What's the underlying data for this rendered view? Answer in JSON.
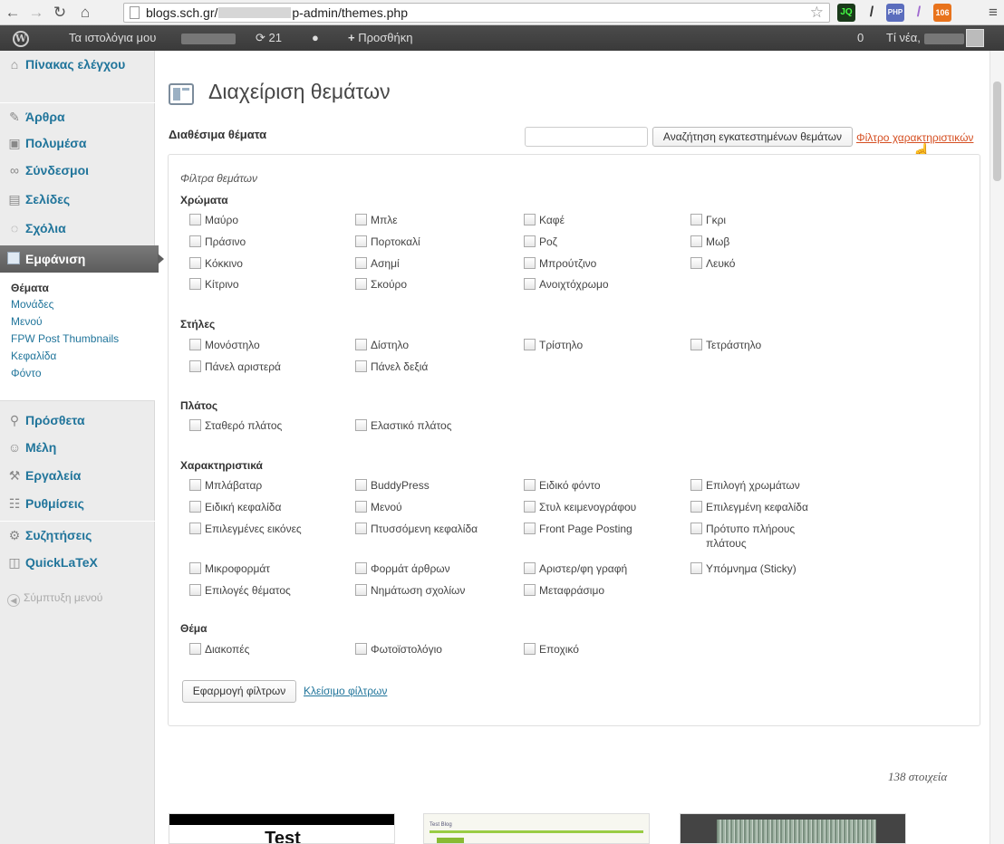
{
  "browser": {
    "url_prefix": "blogs.sch.gr/",
    "url_suffix": "p-admin/themes.php",
    "extensions": [
      "JQ",
      "PHP",
      "106"
    ]
  },
  "adminbar": {
    "my_blogs": "Τα ιστολόγια μου",
    "updates_count": "21",
    "add_new": "Προσθήκη",
    "notif_count": "0",
    "howdy": "Τί νέα,"
  },
  "sidebar": {
    "items": [
      {
        "label": "Πίνακας ελέγχου",
        "icon": "dashboard-icon"
      },
      {
        "label": "Άρθρα",
        "icon": "pin-icon"
      },
      {
        "label": "Πολυμέσα",
        "icon": "media-icon"
      },
      {
        "label": "Σύνδεσμοι",
        "icon": "link-icon"
      },
      {
        "label": "Σελίδες",
        "icon": "pages-icon"
      },
      {
        "label": "Σχόλια",
        "icon": "comments-icon"
      },
      {
        "label": "Εμφάνιση",
        "icon": "appearance-icon"
      },
      {
        "label": "Πρόσθετα",
        "icon": "plugins-icon"
      },
      {
        "label": "Μέλη",
        "icon": "users-icon"
      },
      {
        "label": "Εργαλεία",
        "icon": "tools-icon"
      },
      {
        "label": "Ρυθμίσεις",
        "icon": "settings-icon"
      },
      {
        "label": "Συζητήσεις",
        "icon": "gear-icon"
      },
      {
        "label": "QuickLaTeX",
        "icon": "quicklatex-icon"
      }
    ],
    "submenu": [
      "Θέματα",
      "Μονάδες",
      "Μενού",
      "FPW Post Thumbnails",
      "Κεφαλίδα",
      "Φόντο"
    ],
    "collapse": "Σύμπτυξη μενού"
  },
  "main": {
    "title": "Διαχείριση θεμάτων",
    "available": "Διαθέσιμα θέματα",
    "search_button": "Αναζήτηση εγκατεστημένων θεμάτων",
    "feature_filter": "Φίλτρο χαρακτηριστικών",
    "filters_title": "Φίλτρα θεμάτων",
    "groups": {
      "colors": {
        "title": "Χρώματα",
        "items": [
          "Μαύρο",
          "Μπλε",
          "Καφέ",
          "Γκρι",
          "Πράσινο",
          "Πορτοκαλί",
          "Ροζ",
          "Μωβ",
          "Κόκκινο",
          "Ασημί",
          "Μπρούτζινο",
          "Λευκό",
          "Κίτρινο",
          "Σκούρο",
          "Ανοιχτόχρωμο"
        ]
      },
      "columns": {
        "title": "Στήλες",
        "items": [
          "Μονόστηλο",
          "Δίστηλο",
          "Τρίστηλο",
          "Τετράστηλο",
          "Πάνελ αριστερά",
          "Πάνελ δεξιά"
        ]
      },
      "width": {
        "title": "Πλάτος",
        "items": [
          "Σταθερό πλάτος",
          "Ελαστικό πλάτος"
        ]
      },
      "features": {
        "title": "Χαρακτηριστικά",
        "items": [
          "Μπλάβαταρ",
          "BuddyPress",
          "Ειδικό φόντο",
          "Επιλογή χρωμάτων",
          "Ειδική κεφαλίδα",
          "Μενού",
          "Στυλ κειμενογράφου",
          "Επιλεγμένη κεφαλίδα",
          "Επιλεγμένες εικόνες",
          "Πτυσσόμενη κεφαλίδα",
          "Front Page Posting",
          "Πρότυπο πλήρους πλάτους",
          "Μικροφορμάτ",
          "Φορμάτ άρθρων",
          "Αριστερ/φη γραφή",
          "Υπόμνημα (Sticky)",
          "Επιλογές θέματος",
          "Νημάτωση σχολίων",
          "Μεταφράσιμο"
        ]
      },
      "subject": {
        "title": "Θέμα",
        "items": [
          "Διακοπές",
          "Φωτοϊστολόγιο",
          "Εποχικό"
        ]
      }
    },
    "apply_button": "Εφαρμογή φίλτρων",
    "close_link": "Κλείσιμο φίλτρων",
    "count": "138 στοιχεία",
    "thumbs": [
      "Test",
      "Test Blog"
    ]
  }
}
